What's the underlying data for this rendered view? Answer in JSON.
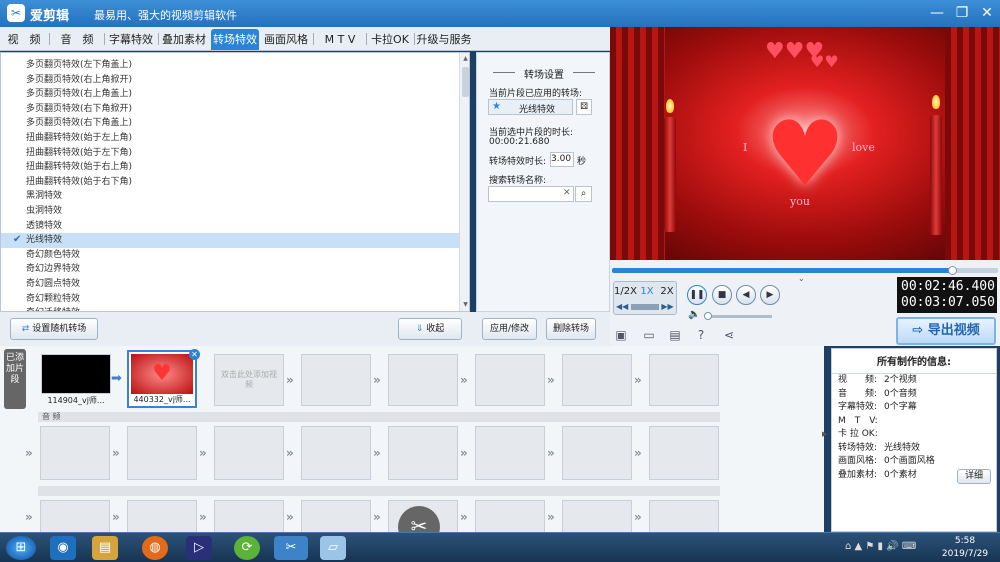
{
  "window": {
    "app_name": "爱剪辑",
    "slogan": "最易用、强大的视频剪辑软件",
    "min": "—",
    "max": "❐",
    "close": "✕"
  },
  "tabs": [
    "视　频",
    "音　频",
    "字幕特效",
    "叠加素材",
    "转场特效",
    "画面风格",
    "M T V",
    "卡拉OK",
    "升级与服务"
  ],
  "active_tab": "转场特效",
  "effects": [
    "多页翻页特效(左下角盖上)",
    "多页翻页特效(右上角掀开)",
    "多页翻页特效(右上角盖上)",
    "多页翻页特效(右下角掀开)",
    "多页翻页特效(右下角盖上)",
    "扭曲翻转特效(始于左上角)",
    "扭曲翻转特效(始于左下角)",
    "扭曲翻转特效(始于右上角)",
    "扭曲翻转特效(始于右下角)",
    "黑洞特效",
    "虫洞特效",
    "透镜特效",
    "光线特效",
    "奇幻颜色特效",
    "奇幻边界特效",
    "奇幻圆点特效",
    "奇幻颗粒特效",
    "奇幻迁移特效"
  ],
  "selected_effect": "光线特效",
  "settings": {
    "title": "转场设置",
    "applied_label": "当前片段已应用的转场:",
    "applied_value": "光线特效",
    "duration_label": "当前选中片段的时长:",
    "duration_value": "00:00:21.680",
    "effect_duration_label": "转场特效时长:",
    "effect_duration_value": "3.00",
    "effect_duration_unit": "秒",
    "search_label": "搜索转场名称:",
    "search_value": ""
  },
  "buttons": {
    "random": "设置随机转场",
    "collect": "收起",
    "apply": "应用/修改",
    "delete": "删除转场"
  },
  "preview": {
    "text_i": "I",
    "text_love": "love",
    "text_you": "you"
  },
  "player": {
    "speeds": [
      "1/2X",
      "1X",
      "2X"
    ],
    "active_speed": "1X",
    "progress": 0.88,
    "current_time": "00:02:46.400",
    "total_time": "00:03:07.050",
    "export_label": "导出视频"
  },
  "timeline": {
    "added_tab": "已添加片段",
    "clips": [
      {
        "name": "114904_vj师..."
      },
      {
        "name": "440332_vj师..."
      }
    ],
    "placeholder": "双击此处添加视频",
    "audio_label": "音 频"
  },
  "info": {
    "title": "所有制作的信息:",
    "rows": [
      {
        "k": "视　　频:",
        "v": "2个视频"
      },
      {
        "k": "音　　频:",
        "v": "0个音频"
      },
      {
        "k": "字幕特效:",
        "v": "0个字幕"
      },
      {
        "k": "M　T　V:",
        "v": ""
      },
      {
        "k": "卡 拉 OK:",
        "v": ""
      },
      {
        "k": "转场特效:",
        "v": "光线特效"
      },
      {
        "k": "画面风格:",
        "v": "0个画面风格"
      },
      {
        "k": "叠加素材:",
        "v": "0个素材"
      }
    ],
    "detail": "详细"
  },
  "clock": {
    "time": "5:58",
    "date": "2019/7/29"
  },
  "colors": {
    "accent": "#2b83d6",
    "titlebar": "#2571bd",
    "selected_row": "#c7e0f7"
  }
}
